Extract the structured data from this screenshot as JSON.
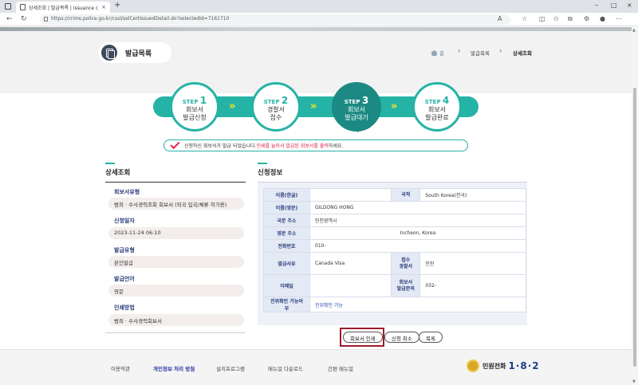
{
  "browser": {
    "tab_title": "상세조회 | 발급목록 | Issuance c",
    "url": "https://crims.police.go.kr/cssl/selCertIssuedDetail.do?selectedId=7161710"
  },
  "header": {
    "page_title": "발급목록",
    "breadcrumb": {
      "home": "홈",
      "level1": "발급목록",
      "current": "상세조회"
    }
  },
  "steps": [
    {
      "label": "STEP",
      "num": "1",
      "line1": "회보서",
      "line2": "발급신청"
    },
    {
      "label": "STEP",
      "num": "2",
      "line1": "경찰서",
      "line2": "접수"
    },
    {
      "label": "STEP",
      "num": "3",
      "line1": "회보서",
      "line2": "발급대기"
    },
    {
      "label": "STEP",
      "num": "4",
      "line1": "회보서",
      "line2": "발급완료"
    }
  ],
  "notice": {
    "text_prefix": "신청하신 회보서가 발급 되었습니다.",
    "text_highlight": "인쇄를 눌러서 발급된 회보서를 출력",
    "text_suffix": "하세요."
  },
  "detail": {
    "heading": "상세조회",
    "fields": [
      {
        "label": "회보서유형",
        "value": "범죄 · 수사경력조회 회보서 (외국 입국/체류 허가용)"
      },
      {
        "label": "신청일자",
        "value": "2023-11-24 06:10"
      },
      {
        "label": "발급유형",
        "value": "본인발급"
      },
      {
        "label": "발급언어",
        "value": "영문"
      },
      {
        "label": "인쇄방법",
        "value": "범죄 · 수사경력회보서"
      }
    ]
  },
  "application": {
    "heading": "신청정보",
    "name_kr_label": "이름(한글)",
    "name_kr": "",
    "nationality_label": "국적",
    "nationality": "South Korea(한국)",
    "name_en_label": "이름(영문)",
    "name_en": "GILDONG HONG",
    "domestic_addr_label": "국문 주소",
    "domestic_addr": "인천광역시",
    "english_addr_label": "영문 주소",
    "english_addr": "Incheon, Korea",
    "phone_label": "전화번호",
    "phone": "010-",
    "purpose_label": "발급사유",
    "purpose": "Canada Visa",
    "station_label1": "접수",
    "station_label2": "경찰서",
    "station": "인천",
    "email_label": "이메일",
    "email": "",
    "inquiry_label1": "회보서",
    "inquiry_label2": "발급문의",
    "inquiry": "032-",
    "verify_label": "진위확인 가능여부",
    "verify": "진위확인 가능"
  },
  "buttons": {
    "print": "회보서 인쇄",
    "cancel": "신청 취소",
    "list": "목록"
  },
  "footer": {
    "links": [
      "이용약관",
      "개인정보 처리 방침",
      "설치프로그램",
      "매뉴얼 다운로드",
      "간편 매뉴얼"
    ],
    "hotline_label": "민원전화",
    "hotline_number": "1·8·2"
  }
}
